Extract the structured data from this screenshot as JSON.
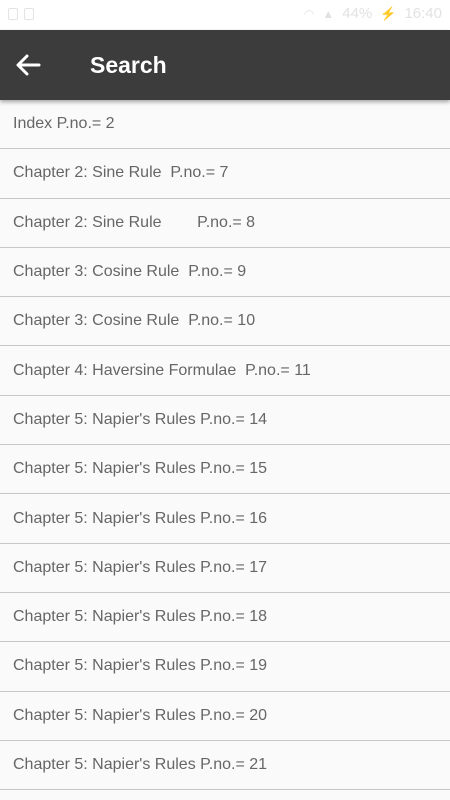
{
  "status_bar": {
    "percent": "44%",
    "time": "16:40",
    "left_icons": [
      "image-icon",
      "notification-icon"
    ]
  },
  "app_bar": {
    "title": "Search",
    "back_icon": "arrow-left-icon"
  },
  "results": [
    {
      "label": "Index P.no.= 2"
    },
    {
      "label": "Chapter 2: Sine Rule  P.no.= 7"
    },
    {
      "label": "Chapter 2: Sine Rule        P.no.= 8"
    },
    {
      "label": "Chapter 3: Cosine Rule  P.no.= 9"
    },
    {
      "label": "Chapter 3: Cosine Rule  P.no.= 10"
    },
    {
      "label": "Chapter 4: Haversine Formulae  P.no.= 11"
    },
    {
      "label": "Chapter 5: Napier's Rules P.no.= 14"
    },
    {
      "label": "Chapter 5: Napier's Rules P.no.= 15"
    },
    {
      "label": "Chapter 5: Napier's Rules P.no.= 16"
    },
    {
      "label": "Chapter 5: Napier's Rules P.no.= 17"
    },
    {
      "label": "Chapter 5: Napier's Rules P.no.= 18"
    },
    {
      "label": "Chapter 5: Napier's Rules P.no.= 19"
    },
    {
      "label": "Chapter 5: Napier's Rules P.no.= 20"
    },
    {
      "label": "Chapter 5: Napier's Rules P.no.= 21"
    }
  ]
}
